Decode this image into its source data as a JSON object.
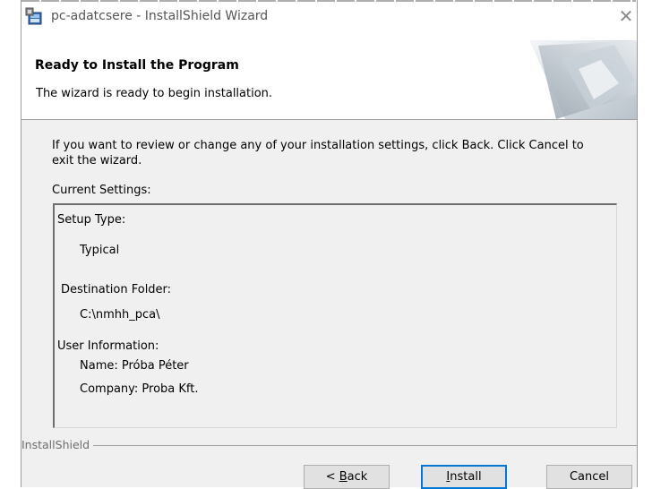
{
  "window": {
    "title": "pc-adatcsere - InstallShield Wizard",
    "close_symbol": "✕"
  },
  "banner": {
    "title": "Ready to Install the Program",
    "subtitle": "The wizard is ready to begin installation."
  },
  "intro": {
    "line1": "If you want to review or change any of your installation settings, click Back. Click Cancel to",
    "line2": "exit the wizard."
  },
  "settings": {
    "label": "Current Settings:",
    "setup_type_label": "Setup Type:",
    "setup_type_value": "Typical",
    "destination_label": "Destination Folder:",
    "destination_value": "C:\\nmhh_pca\\",
    "user_info_label": "User Information:",
    "name_line": "Name: Próba Péter",
    "company_line": "Company: Proba Kft."
  },
  "footer": {
    "brand": "InstallShield"
  },
  "buttons": {
    "back_prefix": "< ",
    "back_mnemonic": "B",
    "back_rest": "ack",
    "install_mnemonic": "I",
    "install_rest": "nstall",
    "cancel": "Cancel"
  }
}
